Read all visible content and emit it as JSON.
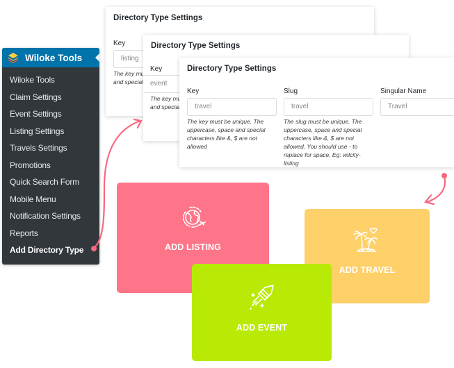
{
  "sidebar": {
    "title": "Wiloke Tools",
    "icon": "layers-icon",
    "items": [
      {
        "label": "Wiloke Tools"
      },
      {
        "label": "Claim Settings"
      },
      {
        "label": "Event Settings"
      },
      {
        "label": "Listing Settings"
      },
      {
        "label": "Travels Settings"
      },
      {
        "label": "Promotions"
      },
      {
        "label": "Quick Search Form"
      },
      {
        "label": "Mobile Menu"
      },
      {
        "label": "Notification Settings"
      },
      {
        "label": "Reports"
      },
      {
        "label": "Add Directory Type",
        "current": true
      }
    ]
  },
  "panels": [
    {
      "title": "Directory Type Settings",
      "key_label": "Key",
      "key_value": "listing",
      "key_help": "The key must be unique. The uppercase, space and special characters like &, $ are not allowed"
    },
    {
      "title": "Directory Type Settings",
      "key_label": "Key",
      "key_value": "event",
      "key_help": "The key must be unique. The uppercase, space and special characters like &, $ are not allowed"
    },
    {
      "title": "Directory Type Settings",
      "key_label": "Key",
      "key_value": "travel",
      "key_help": "The key must be unique. The uppercase, space and special characters like &, $ are not allowed",
      "slug_label": "Slug",
      "slug_value": "travel",
      "slug_help": "The slug must be unique. The uppercase, space and special characters like &, $ are not allowed. You should use - to replace for space. Eg: wilcity-listing",
      "singular_label": "Singular Name",
      "singular_value": "Travel"
    }
  ],
  "cards": {
    "listing": {
      "label": "ADD LISTING",
      "icon": "globe-plane-icon",
      "color": "#fe7589"
    },
    "event": {
      "label": "ADD EVENT",
      "icon": "firework-rocket-icon",
      "color": "#b8ea06"
    },
    "travel": {
      "label": "ADD TRAVEL",
      "icon": "palm-island-heart-icon",
      "color": "#fed06a"
    }
  },
  "accent": {
    "arrow": "#f7687f",
    "admin_blue": "#0073aa",
    "admin_dark": "#32373c"
  }
}
